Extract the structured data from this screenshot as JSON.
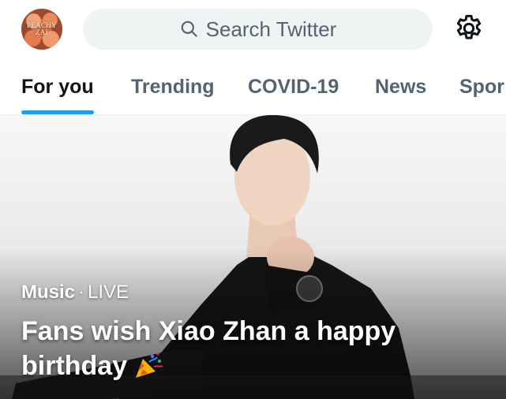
{
  "header": {
    "avatar_text": "PEACHY ZAI",
    "search": {
      "placeholder": "Search Twitter",
      "icon": "search-icon"
    },
    "settings_icon": "gear-icon"
  },
  "tabs": [
    {
      "label": "For you",
      "active": true
    },
    {
      "label": "Trending",
      "active": false
    },
    {
      "label": "COVID-19",
      "active": false
    },
    {
      "label": "News",
      "active": false
    },
    {
      "label": "Spor",
      "active": false
    }
  ],
  "hero": {
    "category": "Music",
    "separator": "·",
    "status": "LIVE",
    "headline": "Fans wish Xiao Zhan a happy birthday",
    "headline_emoji": "party-popper-icon"
  },
  "colors": {
    "accent": "#1d9bf0",
    "search_bg": "#eff3f4",
    "text_primary": "#0f1419",
    "text_secondary": "#536471"
  }
}
